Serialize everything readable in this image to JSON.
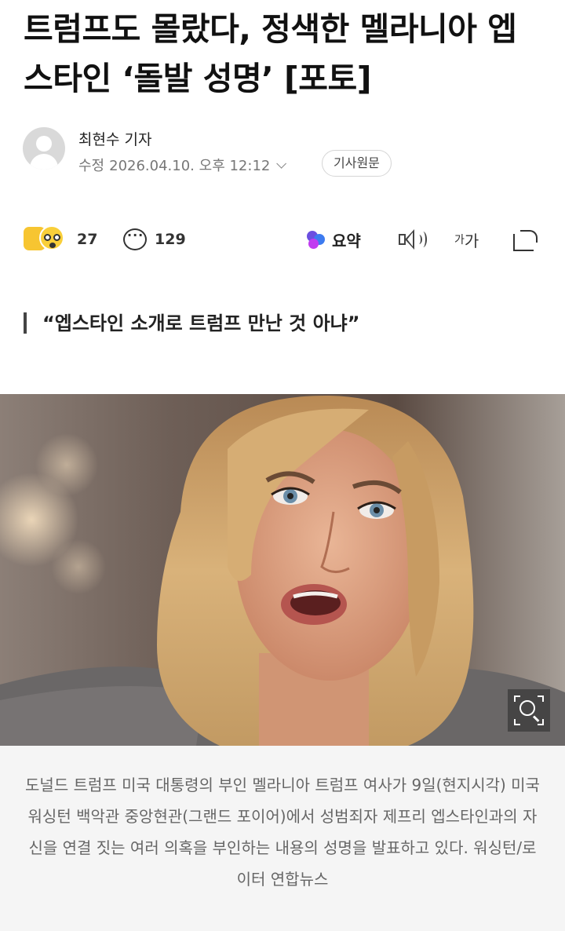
{
  "article": {
    "headline": "트럼프도 몰랐다, 정색한 멜라니아 엡스타인 ‘돌발 성명’ [포토]",
    "reporter": "최현수 기자",
    "modified_label": "수정",
    "modified_datetime": "2026.04.10. 오후 12:12",
    "original_button": "기사원문",
    "subtitle": "“엡스타인 소개로 트럼프 만난 것 아냐”",
    "caption": "도널드 트럼프 미국 대통령의 부인 멜라니아 트럼프 여사가 9일(현지시각) 미국 워싱턴 백악관 중앙현관(그랜드 포이어)에서 성범죄자 제프리 엡스타인과의 자신을 연결 짓는 여러 의혹을 부인하는 내용의 성명을 발표하고 있다. 워싱턴/로이터 연합뉴스"
  },
  "actions": {
    "reaction_count": "27",
    "comment_count": "129",
    "summary_label": "요약",
    "font_size_label_small": "가",
    "font_size_label_large": "가"
  },
  "icons": {
    "avatar": "avatar-placeholder-icon",
    "reaction": "reaction-emoji-icon",
    "comment": "comment-bubble-icon",
    "summary": "ai-summary-icon",
    "tts": "speaker-icon",
    "share": "share-icon",
    "zoom": "photo-zoom-icon"
  },
  "colors": {
    "caption_bg": "#f5f5f5",
    "summary_purple": "#6b4fe0",
    "summary_blue": "#3d7bf0"
  }
}
